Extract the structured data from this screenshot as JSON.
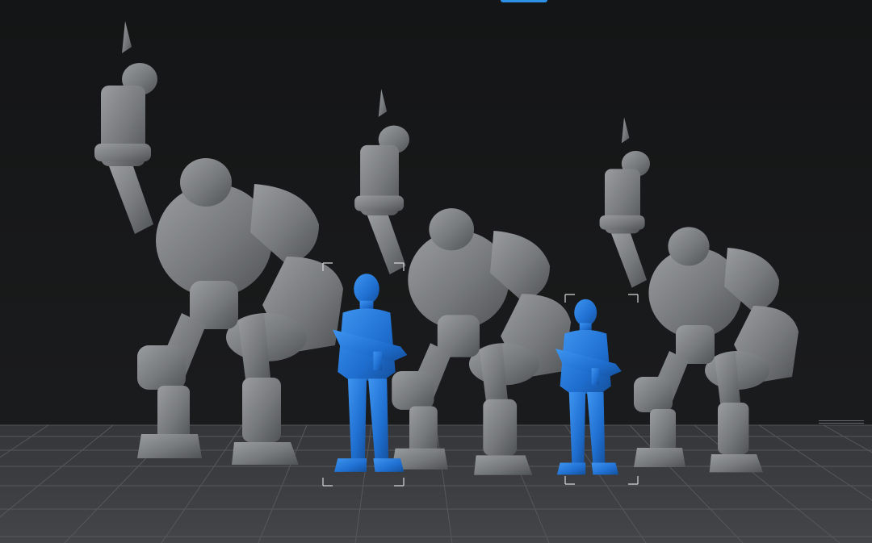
{
  "viewport": {
    "background": "#151617",
    "bed_color": "#3c3d40",
    "grid_line_color": "#55575b"
  },
  "models": {
    "unselected_color": "#7b7e81",
    "selected_color": "#1f6fd1",
    "mech_figures": [
      {
        "name": "mech-left",
        "selected": false
      },
      {
        "name": "mech-center",
        "selected": false
      },
      {
        "name": "mech-right",
        "selected": false
      }
    ],
    "human_figures": [
      {
        "name": "gunman-left",
        "selected": true
      },
      {
        "name": "gunman-right",
        "selected": true
      }
    ]
  },
  "toolbar_indicator": {
    "color": "#2d8fe6",
    "active": true
  }
}
